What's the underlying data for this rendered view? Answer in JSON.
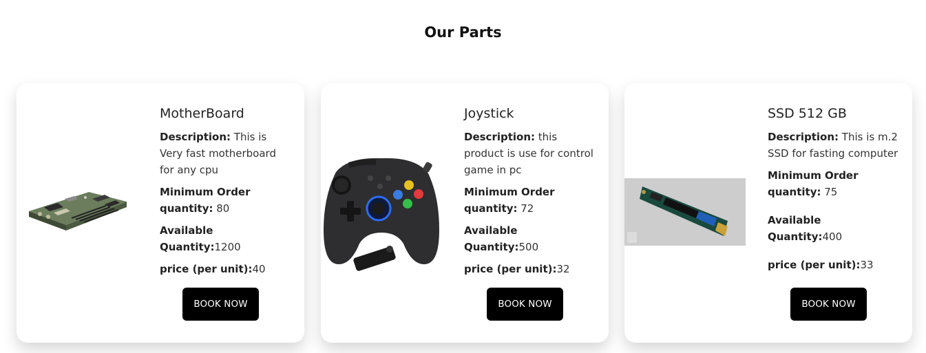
{
  "section_title": "Our Parts",
  "products": [
    {
      "name": "MotherBoard",
      "description_label": "Description:",
      "description": " This is Very fast motherboard for any cpu",
      "min_order_label": "Minimum Order quantity:",
      "min_order": " 80",
      "available_label": "Available Quantity:",
      "available": "1200",
      "price_label": "price (per unit):",
      "price": "40",
      "button": "BOOK NOW",
      "image_icon": "motherboard-image"
    },
    {
      "name": "Joystick",
      "description_label": "Description:",
      "description": " this product is use for control game in pc",
      "min_order_label": "Minimum Order quantity:",
      "min_order": " 72",
      "available_label": "Available Quantity:",
      "available": "500",
      "price_label": "price (per unit):",
      "price": "32",
      "button": "BOOK NOW",
      "image_icon": "joystick-image"
    },
    {
      "name": "SSD 512 GB",
      "description_label": "Description:",
      "description": " This is m.2 SSD for fasting computer",
      "min_order_label": "Minimum Order quantity:",
      "min_order": " 75",
      "available_label": "Available Quantity:",
      "available": "400",
      "price_label": "price (per unit):",
      "price": "33",
      "button": "BOOK NOW",
      "image_icon": "ssd-image"
    }
  ],
  "colors": {
    "button_bg": "#000000",
    "button_text": "#ffffff",
    "card_bg": "#ffffff"
  }
}
